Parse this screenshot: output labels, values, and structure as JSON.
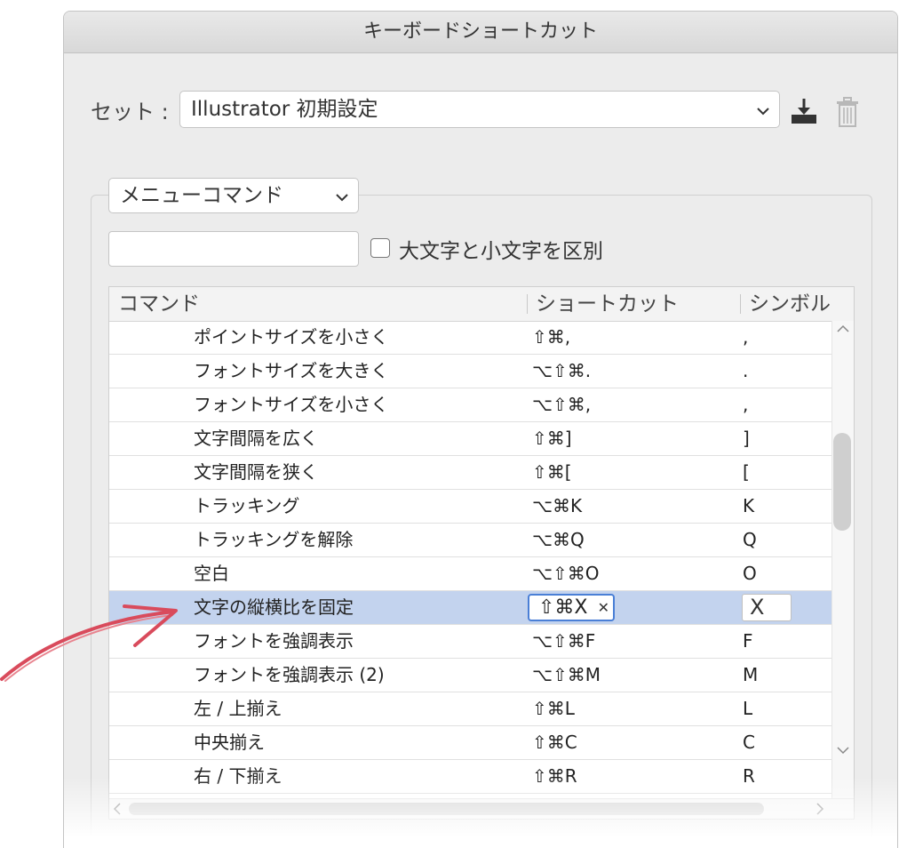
{
  "dialog": {
    "title": "キーボードショートカット"
  },
  "set": {
    "label": "セット :",
    "value": "Illustrator 初期設定"
  },
  "category": {
    "value": "メニューコマンド"
  },
  "search": {
    "value": "",
    "placeholder": ""
  },
  "case_sensitive": {
    "label": "大文字と小文字を区別",
    "checked": false
  },
  "table": {
    "columns": [
      "コマンド",
      "ショートカット",
      "シンボル"
    ],
    "rows": [
      {
        "command": "ポイントサイズを小さく",
        "shortcut": "⇧⌘,",
        "symbol": ","
      },
      {
        "command": "フォントサイズを大きく",
        "shortcut": "⌥⇧⌘.",
        "symbol": "."
      },
      {
        "command": "フォントサイズを小さく",
        "shortcut": "⌥⇧⌘,",
        "symbol": ","
      },
      {
        "command": "文字間隔を広く",
        "shortcut": "⇧⌘]",
        "symbol": "]"
      },
      {
        "command": "文字間隔を狭く",
        "shortcut": "⇧⌘[",
        "symbol": "["
      },
      {
        "command": "トラッキング",
        "shortcut": "⌥⌘K",
        "symbol": "K"
      },
      {
        "command": "トラッキングを解除",
        "shortcut": "⌥⌘Q",
        "symbol": "Q"
      },
      {
        "command": "空白",
        "shortcut": "⌥⇧⌘O",
        "symbol": "O"
      },
      {
        "command": "文字の縦横比を固定",
        "shortcut": "⇧⌘X",
        "symbol": "X",
        "selected": true
      },
      {
        "command": "フォントを強調表示",
        "shortcut": "⌥⇧⌘F",
        "symbol": "F"
      },
      {
        "command": "フォントを強調表示 (2)",
        "shortcut": "⌥⇧⌘M",
        "symbol": "M"
      },
      {
        "command": "左 / 上揃え",
        "shortcut": "⇧⌘L",
        "symbol": "L"
      },
      {
        "command": "中央揃え",
        "shortcut": "⇧⌘C",
        "symbol": "C"
      },
      {
        "command": "右 / 下揃え",
        "shortcut": "⇧⌘R",
        "symbol": "R"
      }
    ]
  },
  "colors": {
    "selection": "#c3d3ee",
    "focus": "#4a7fd6",
    "annotation_arrow": "#d94b5c"
  }
}
